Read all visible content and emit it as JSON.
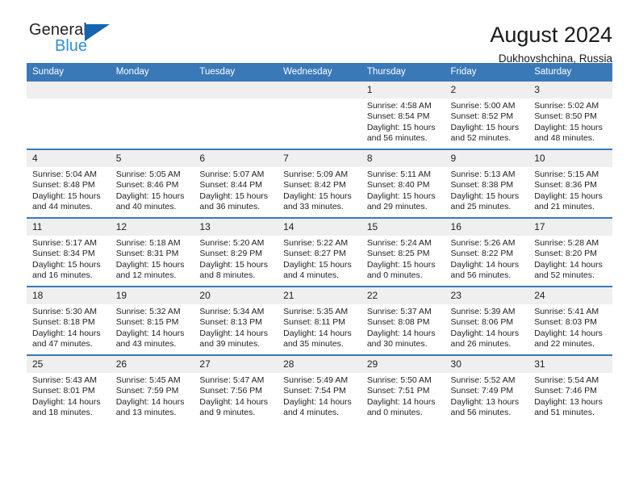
{
  "brand": {
    "name_top": "General",
    "name_bottom": "Blue",
    "triangle_color": "#1464af",
    "blue_text_color": "#2f8fd8"
  },
  "header": {
    "title": "August 2024",
    "subtitle": "Dukhovshchina, Russia",
    "header_bg_color": "#3a79b8",
    "daynum_bg_color": "#efefef"
  },
  "weekdays": [
    "Sunday",
    "Monday",
    "Tuesday",
    "Wednesday",
    "Thursday",
    "Friday",
    "Saturday"
  ],
  "weeks": [
    [
      {
        "day": "",
        "empty": true
      },
      {
        "day": "",
        "empty": true
      },
      {
        "day": "",
        "empty": true
      },
      {
        "day": "",
        "empty": true
      },
      {
        "day": "1",
        "sunrise": "Sunrise: 4:58 AM",
        "sunset": "Sunset: 8:54 PM",
        "daylight_1": "Daylight: 15 hours",
        "daylight_2": "and 56 minutes."
      },
      {
        "day": "2",
        "sunrise": "Sunrise: 5:00 AM",
        "sunset": "Sunset: 8:52 PM",
        "daylight_1": "Daylight: 15 hours",
        "daylight_2": "and 52 minutes."
      },
      {
        "day": "3",
        "sunrise": "Sunrise: 5:02 AM",
        "sunset": "Sunset: 8:50 PM",
        "daylight_1": "Daylight: 15 hours",
        "daylight_2": "and 48 minutes."
      }
    ],
    [
      {
        "day": "4",
        "sunrise": "Sunrise: 5:04 AM",
        "sunset": "Sunset: 8:48 PM",
        "daylight_1": "Daylight: 15 hours",
        "daylight_2": "and 44 minutes."
      },
      {
        "day": "5",
        "sunrise": "Sunrise: 5:05 AM",
        "sunset": "Sunset: 8:46 PM",
        "daylight_1": "Daylight: 15 hours",
        "daylight_2": "and 40 minutes."
      },
      {
        "day": "6",
        "sunrise": "Sunrise: 5:07 AM",
        "sunset": "Sunset: 8:44 PM",
        "daylight_1": "Daylight: 15 hours",
        "daylight_2": "and 36 minutes."
      },
      {
        "day": "7",
        "sunrise": "Sunrise: 5:09 AM",
        "sunset": "Sunset: 8:42 PM",
        "daylight_1": "Daylight: 15 hours",
        "daylight_2": "and 33 minutes."
      },
      {
        "day": "8",
        "sunrise": "Sunrise: 5:11 AM",
        "sunset": "Sunset: 8:40 PM",
        "daylight_1": "Daylight: 15 hours",
        "daylight_2": "and 29 minutes."
      },
      {
        "day": "9",
        "sunrise": "Sunrise: 5:13 AM",
        "sunset": "Sunset: 8:38 PM",
        "daylight_1": "Daylight: 15 hours",
        "daylight_2": "and 25 minutes."
      },
      {
        "day": "10",
        "sunrise": "Sunrise: 5:15 AM",
        "sunset": "Sunset: 8:36 PM",
        "daylight_1": "Daylight: 15 hours",
        "daylight_2": "and 21 minutes."
      }
    ],
    [
      {
        "day": "11",
        "sunrise": "Sunrise: 5:17 AM",
        "sunset": "Sunset: 8:34 PM",
        "daylight_1": "Daylight: 15 hours",
        "daylight_2": "and 16 minutes."
      },
      {
        "day": "12",
        "sunrise": "Sunrise: 5:18 AM",
        "sunset": "Sunset: 8:31 PM",
        "daylight_1": "Daylight: 15 hours",
        "daylight_2": "and 12 minutes."
      },
      {
        "day": "13",
        "sunrise": "Sunrise: 5:20 AM",
        "sunset": "Sunset: 8:29 PM",
        "daylight_1": "Daylight: 15 hours",
        "daylight_2": "and 8 minutes."
      },
      {
        "day": "14",
        "sunrise": "Sunrise: 5:22 AM",
        "sunset": "Sunset: 8:27 PM",
        "daylight_1": "Daylight: 15 hours",
        "daylight_2": "and 4 minutes."
      },
      {
        "day": "15",
        "sunrise": "Sunrise: 5:24 AM",
        "sunset": "Sunset: 8:25 PM",
        "daylight_1": "Daylight: 15 hours",
        "daylight_2": "and 0 minutes."
      },
      {
        "day": "16",
        "sunrise": "Sunrise: 5:26 AM",
        "sunset": "Sunset: 8:22 PM",
        "daylight_1": "Daylight: 14 hours",
        "daylight_2": "and 56 minutes."
      },
      {
        "day": "17",
        "sunrise": "Sunrise: 5:28 AM",
        "sunset": "Sunset: 8:20 PM",
        "daylight_1": "Daylight: 14 hours",
        "daylight_2": "and 52 minutes."
      }
    ],
    [
      {
        "day": "18",
        "sunrise": "Sunrise: 5:30 AM",
        "sunset": "Sunset: 8:18 PM",
        "daylight_1": "Daylight: 14 hours",
        "daylight_2": "and 47 minutes."
      },
      {
        "day": "19",
        "sunrise": "Sunrise: 5:32 AM",
        "sunset": "Sunset: 8:15 PM",
        "daylight_1": "Daylight: 14 hours",
        "daylight_2": "and 43 minutes."
      },
      {
        "day": "20",
        "sunrise": "Sunrise: 5:34 AM",
        "sunset": "Sunset: 8:13 PM",
        "daylight_1": "Daylight: 14 hours",
        "daylight_2": "and 39 minutes."
      },
      {
        "day": "21",
        "sunrise": "Sunrise: 5:35 AM",
        "sunset": "Sunset: 8:11 PM",
        "daylight_1": "Daylight: 14 hours",
        "daylight_2": "and 35 minutes."
      },
      {
        "day": "22",
        "sunrise": "Sunrise: 5:37 AM",
        "sunset": "Sunset: 8:08 PM",
        "daylight_1": "Daylight: 14 hours",
        "daylight_2": "and 30 minutes."
      },
      {
        "day": "23",
        "sunrise": "Sunrise: 5:39 AM",
        "sunset": "Sunset: 8:06 PM",
        "daylight_1": "Daylight: 14 hours",
        "daylight_2": "and 26 minutes."
      },
      {
        "day": "24",
        "sunrise": "Sunrise: 5:41 AM",
        "sunset": "Sunset: 8:03 PM",
        "daylight_1": "Daylight: 14 hours",
        "daylight_2": "and 22 minutes."
      }
    ],
    [
      {
        "day": "25",
        "sunrise": "Sunrise: 5:43 AM",
        "sunset": "Sunset: 8:01 PM",
        "daylight_1": "Daylight: 14 hours",
        "daylight_2": "and 18 minutes."
      },
      {
        "day": "26",
        "sunrise": "Sunrise: 5:45 AM",
        "sunset": "Sunset: 7:59 PM",
        "daylight_1": "Daylight: 14 hours",
        "daylight_2": "and 13 minutes."
      },
      {
        "day": "27",
        "sunrise": "Sunrise: 5:47 AM",
        "sunset": "Sunset: 7:56 PM",
        "daylight_1": "Daylight: 14 hours",
        "daylight_2": "and 9 minutes."
      },
      {
        "day": "28",
        "sunrise": "Sunrise: 5:49 AM",
        "sunset": "Sunset: 7:54 PM",
        "daylight_1": "Daylight: 14 hours",
        "daylight_2": "and 4 minutes."
      },
      {
        "day": "29",
        "sunrise": "Sunrise: 5:50 AM",
        "sunset": "Sunset: 7:51 PM",
        "daylight_1": "Daylight: 14 hours",
        "daylight_2": "and 0 minutes."
      },
      {
        "day": "30",
        "sunrise": "Sunrise: 5:52 AM",
        "sunset": "Sunset: 7:49 PM",
        "daylight_1": "Daylight: 13 hours",
        "daylight_2": "and 56 minutes."
      },
      {
        "day": "31",
        "sunrise": "Sunrise: 5:54 AM",
        "sunset": "Sunset: 7:46 PM",
        "daylight_1": "Daylight: 13 hours",
        "daylight_2": "and 51 minutes."
      }
    ]
  ]
}
